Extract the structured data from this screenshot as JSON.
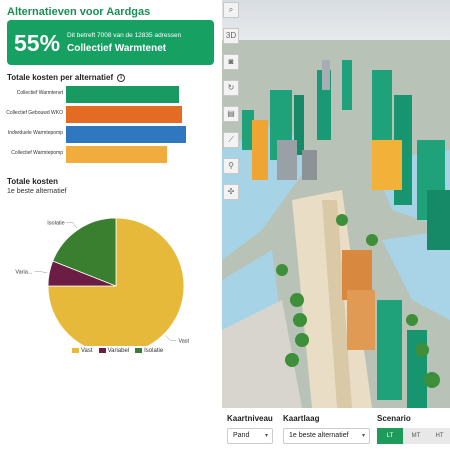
{
  "header": {
    "title": "Alternatieven voor Aardgas"
  },
  "summary": {
    "percentage": "55%",
    "subtitle": "Dit betreft 7008 van de 12835 adressen",
    "alternative": "Collectief Warmtenet",
    "color": "#16a062"
  },
  "costs": {
    "title": "Totale kosten per alternatief",
    "info_icon": "info-icon",
    "chart_data": {
      "type": "bar",
      "orientation": "horizontal",
      "categories": [
        "Collectief Warmtenet",
        "Collectief Gebouwd WKO",
        "Individuele Warmtepomp",
        "Collectief Warmtepomp"
      ],
      "values": [
        0.93,
        0.95,
        0.98,
        0.83
      ],
      "colors": [
        "#1a9a63",
        "#e36b24",
        "#2f78c0",
        "#f0ad3e"
      ],
      "xlabel": "",
      "ylabel": "",
      "xlim": [
        0,
        1
      ]
    }
  },
  "totals": {
    "title": "Totale kosten",
    "subtitle": "1e beste alternatief",
    "chart_data": {
      "type": "pie",
      "categories": [
        "Vast",
        "Variabel",
        "Isolatie"
      ],
      "short_labels": [
        "Vast",
        "Varia...",
        "Isolatie"
      ],
      "values": [
        75,
        6,
        19
      ],
      "colors": [
        "#e6b93b",
        "#6b1d43",
        "#3a7f2f"
      ],
      "legend_position": "bottom"
    }
  },
  "toolbar": {
    "items": [
      {
        "icon": "search-icon",
        "glyph": "⌕"
      },
      {
        "icon": "3d-toggle-icon",
        "glyph": "3D"
      },
      {
        "icon": "camera-icon",
        "glyph": "◙"
      },
      {
        "icon": "rotate-icon",
        "glyph": "↻"
      },
      {
        "icon": "layers-icon",
        "glyph": "▤"
      },
      {
        "icon": "measure-icon",
        "glyph": "⟋"
      },
      {
        "icon": "walk-icon",
        "glyph": "⚲"
      },
      {
        "icon": "share-icon",
        "glyph": "✣"
      }
    ]
  },
  "controls": {
    "map_level_label": "Kaartniveau",
    "map_level_value": "Pand",
    "map_layer_label": "Kaartlaag",
    "map_layer_value": "1e beste alternatief",
    "scenario_label": "Scenario",
    "scenario_options": [
      "LT",
      "MT",
      "HT"
    ],
    "scenario_selected": "LT"
  }
}
